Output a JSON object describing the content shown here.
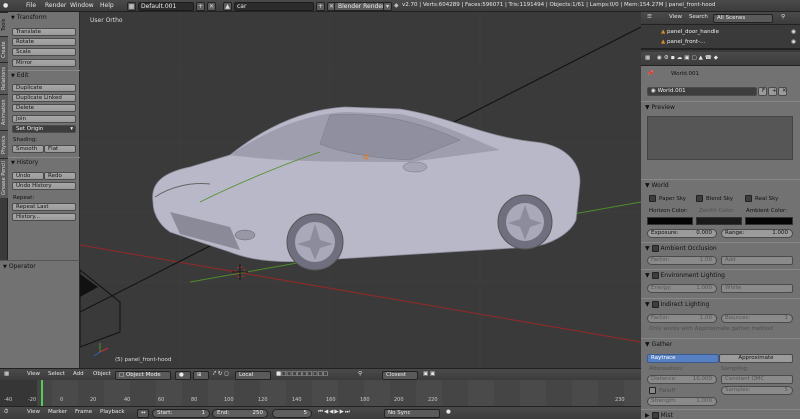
{
  "info_header": {
    "menus": [
      "File",
      "Render",
      "Window",
      "Help"
    ],
    "screen_layout": "Default.001",
    "scene": "car",
    "render_engine": "Blender Render",
    "stats": "v2.70 | Verts:604289 | Faces:596071 | Tris:1191494 | Objects:1/61 | Lamps:0/0 | Mem:154.27M | panel_front-hood"
  },
  "tool_tabs": [
    "Tools",
    "Create",
    "Relations",
    "Animation",
    "Physics",
    "Grease Pencil"
  ],
  "tool_shelf": {
    "transform": {
      "title": "Transform",
      "buttons": [
        "Translate",
        "Rotate",
        "Scale",
        "Mirror"
      ]
    },
    "edit": {
      "title": "Edit",
      "buttons": [
        "Duplicate",
        "Duplicate Linked",
        "Delete",
        "Join"
      ],
      "set_origin": "Set Origin",
      "shading_label": "Shading:",
      "smooth": "Smooth",
      "flat": "Flat"
    },
    "history": {
      "title": "History",
      "undo": "Undo",
      "redo": "Redo",
      "undo_history": "Undo History",
      "repeat_label": "Repeat:",
      "repeat_last": "Repeat Last",
      "history_btn": "History..."
    }
  },
  "operator": {
    "title": "Operator"
  },
  "viewport": {
    "view_name": "User Ortho",
    "object_label": "(5) panel_front-hood"
  },
  "viewport_header": {
    "view": "View",
    "select": "Select",
    "add": "Add",
    "object": "Object",
    "mode": "Object Mode",
    "orientation": "Local",
    "snap": "Closest"
  },
  "timeline": {
    "ticks": [
      "-40",
      "-20",
      "0",
      "20",
      "40",
      "60",
      "80",
      "100",
      "120",
      "140",
      "160",
      "180",
      "200",
      "220",
      "230"
    ],
    "current_frame": 5
  },
  "timeline_header": {
    "view": "View",
    "marker": "Marker",
    "frame": "Frame",
    "playback": "Playback",
    "start": "Start:",
    "start_value": "1",
    "end": "End:",
    "end_value": "250",
    "current_frame": "5",
    "sync": "No Sync"
  },
  "outliner": {
    "view": "View",
    "search": "Search",
    "scope": "All Scenes",
    "rows": [
      "panel_door_handle",
      "panel_front-..."
    ]
  },
  "properties": {
    "breadcrumb": "World.001",
    "world_name": "World.001",
    "world_fake": "F",
    "preview_title": "Preview",
    "world_title": "World",
    "paper_sky": "Paper Sky",
    "blend_sky": "Blend Sky",
    "real_sky": "Real Sky",
    "horizon_color": "Horizon Color:",
    "zenith_color": "Zenith Color:",
    "ambient_color": "Ambient Color:",
    "exposure": "Exposure:",
    "exposure_value": "0.000",
    "range": "Range:",
    "range_value": "1.000",
    "ao_title": "Ambient Occlusion",
    "ao_factor": "Factor:",
    "ao_factor_value": "1.00",
    "ao_blend": "Add",
    "env_title": "Environment Lighting",
    "env_energy": "Energy:",
    "env_energy_value": "1.000",
    "env_color": "White",
    "ind_title": "Indirect Lighting",
    "ind_factor": "Factor:",
    "ind_factor_value": "1.00",
    "ind_bounces": "Bounces:",
    "ind_bounces_value": "1",
    "ind_note": "Only works with Approximate gather method",
    "gather_title": "Gather",
    "raytrace": "Raytrace",
    "approximate": "Approximate",
    "attenuation": "Attenuation:",
    "sampling": "Sampling:",
    "distance": "Distance:",
    "distance_value": "10.000",
    "constant_qmc": "Constant QMC",
    "falloff": "Falloff",
    "samples": "Samples:",
    "samples_value": "5",
    "strength": "Strength:",
    "strength_value": "1.000",
    "mist_title": "Mist"
  },
  "colors": {
    "viewport_bg": "#3a3a3a",
    "panel_bg": "#727272",
    "header_bg": "#444444",
    "raytrace_active": "#5680c2",
    "x_axis": "#a02828",
    "y_axis": "#5aa02a",
    "car_body": "#b6b6c6"
  }
}
